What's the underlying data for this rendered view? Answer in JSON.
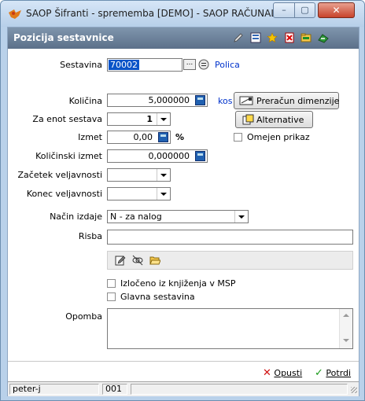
{
  "window": {
    "title": "SAOP Šifranti - sprememba [DEMO] - SAOP RAČUNAL...",
    "min_glyph": "–",
    "max_glyph": "▢",
    "close_glyph": "✕"
  },
  "header": {
    "title": "Pozicija sestavnice",
    "icons": [
      "edit-icon",
      "list-icon",
      "star-icon",
      "delete-icon",
      "folder-icon",
      "exit-icon"
    ]
  },
  "form": {
    "sestavina": {
      "label": "Sestavina",
      "value": "70002",
      "ellipsis": "...",
      "link": "Polica"
    },
    "kolicina": {
      "label": "Količina",
      "value": "5,000000",
      "unit": "kos",
      "button": "Preračun dimenzije"
    },
    "za_enot": {
      "label": "Za enot sestava",
      "value": "1",
      "button": "Alternative"
    },
    "izmet": {
      "label": "Izmet",
      "value": "0,00",
      "unit": "%"
    },
    "omejen": {
      "label": "Omejen prikaz",
      "checked": false
    },
    "kolicinski_izmet": {
      "label": "Količinski izmet",
      "value": "0,000000"
    },
    "zacetek": {
      "label": "Začetek veljavnosti",
      "value": ""
    },
    "konec": {
      "label": "Konec veljavnosti",
      "value": ""
    },
    "nacin": {
      "label": "Način izdaje",
      "value": "N - za nalog"
    },
    "risba": {
      "label": "Risba",
      "value": ""
    },
    "izloceno": {
      "label": "Izločeno iz knjiženja v MSP",
      "checked": false
    },
    "glavna": {
      "label": "Glavna sestavina",
      "checked": false
    },
    "opomba": {
      "label": "Opomba",
      "value": ""
    }
  },
  "footer": {
    "cancel": "Opusti",
    "confirm": "Potrdi"
  },
  "status": {
    "user": "peter-j",
    "code": "001",
    "extra": ""
  },
  "colors": {
    "header": "#6b8099",
    "selection": "#0a54c8",
    "link": "#0033cc"
  }
}
